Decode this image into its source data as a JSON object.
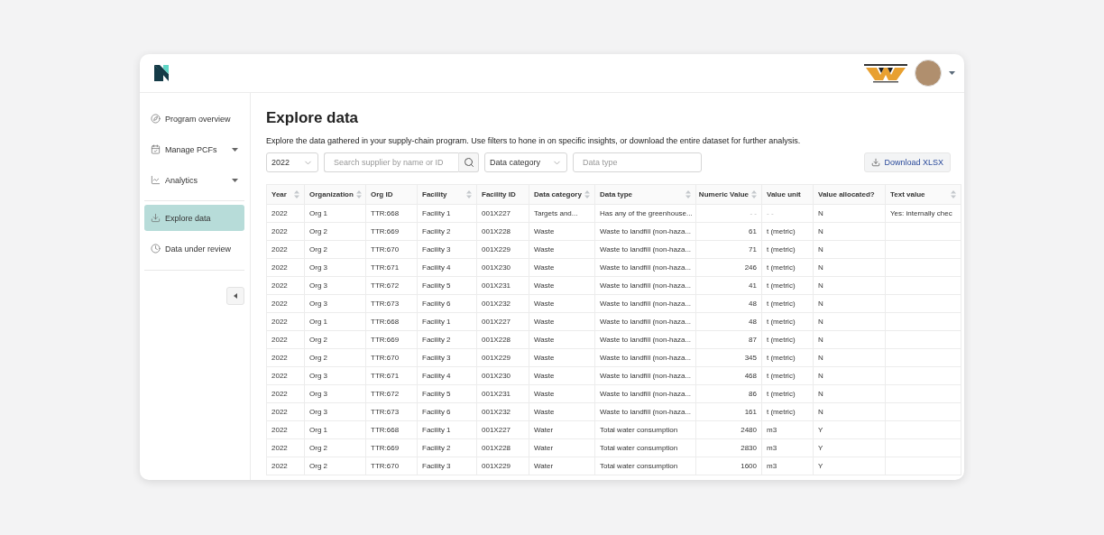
{
  "sidebar": {
    "items": [
      {
        "label": "Program overview",
        "selected": false,
        "expandable": false
      },
      {
        "label": "Manage PCFs",
        "selected": false,
        "expandable": true
      },
      {
        "label": "Analytics",
        "selected": false,
        "expandable": true
      },
      {
        "label": "Explore data",
        "selected": true,
        "expandable": false
      },
      {
        "label": "Data under review",
        "selected": false,
        "expandable": false
      }
    ]
  },
  "page": {
    "title": "Explore data",
    "description": "Explore the data gathered in your supply-chain program. Use filters to hone in on specific insights, or download the entire dataset for further analysis."
  },
  "filters": {
    "year": "2022",
    "search_placeholder": "Search supplier by name or ID",
    "category": "Data category",
    "type_placeholder": "Data type",
    "download": "Download XLSX"
  },
  "table": {
    "columns": [
      {
        "label": "Year",
        "sortable": true,
        "kind": "text"
      },
      {
        "label": "Organization",
        "sortable": true,
        "kind": "text"
      },
      {
        "label": "Org ID",
        "sortable": false,
        "kind": "text"
      },
      {
        "label": "Facility",
        "sortable": true,
        "kind": "text"
      },
      {
        "label": "Facility ID",
        "sortable": false,
        "kind": "text"
      },
      {
        "label": "Data category",
        "sortable": true,
        "kind": "text"
      },
      {
        "label": "Data type",
        "sortable": true,
        "kind": "text"
      },
      {
        "label": "Numeric Value",
        "sortable": true,
        "kind": "number"
      },
      {
        "label": "Value unit",
        "sortable": false,
        "kind": "text"
      },
      {
        "label": "Value allocated?",
        "sortable": false,
        "kind": "text"
      },
      {
        "label": "Text value",
        "sortable": true,
        "kind": "text"
      }
    ],
    "rows": [
      [
        "2022",
        "Org 1",
        "TTR:668",
        "Facility 1",
        "001X227",
        "Targets and...",
        "Has any of the greenhouse...",
        "- -",
        "- -",
        "N",
        "Yes: internally chec"
      ],
      [
        "2022",
        "Org 2",
        "TTR:669",
        "Facility 2",
        "001X228",
        "Waste",
        "Waste to landfill (non-haza...",
        "61",
        "t (metric)",
        "N"
      ],
      [
        "2022",
        "Org 2",
        "TTR:670",
        "Facility 3",
        "001X229",
        "Waste",
        "Waste to landfill (non-haza...",
        "71",
        "t (metric)",
        "N"
      ],
      [
        "2022",
        "Org 3",
        "TTR:671",
        "Facility 4",
        "001X230",
        "Waste",
        "Waste to landfill (non-haza...",
        "246",
        "t (metric)",
        "N"
      ],
      [
        "2022",
        "Org 3",
        "TTR:672",
        "Facility 5",
        "001X231",
        "Waste",
        "Waste to landfill (non-haza...",
        "41",
        "t (metric)",
        "N"
      ],
      [
        "2022",
        "Org 3",
        "TTR:673",
        "Facility 6",
        "001X232",
        "Waste",
        "Waste to landfill (non-haza...",
        "48",
        "t (metric)",
        "N"
      ],
      [
        "2022",
        "Org 1",
        "TTR:668",
        "Facility 1",
        "001X227",
        "Waste",
        "Waste to landfill (non-haza...",
        "48",
        "t (metric)",
        "N"
      ],
      [
        "2022",
        "Org 2",
        "TTR:669",
        "Facility 2",
        "001X228",
        "Waste",
        "Waste to landfill (non-haza...",
        "87",
        "t (metric)",
        "N"
      ],
      [
        "2022",
        "Org 2",
        "TTR:670",
        "Facility 3",
        "001X229",
        "Waste",
        "Waste to landfill (non-haza...",
        "345",
        "t (metric)",
        "N"
      ],
      [
        "2022",
        "Org 3",
        "TTR:671",
        "Facility 4",
        "001X230",
        "Waste",
        "Waste to landfill (non-haza...",
        "468",
        "t (metric)",
        "N"
      ],
      [
        "2022",
        "Org 3",
        "TTR:672",
        "Facility 5",
        "001X231",
        "Waste",
        "Waste to landfill (non-haza...",
        "86",
        "t (metric)",
        "N"
      ],
      [
        "2022",
        "Org 3",
        "TTR:673",
        "Facility 6",
        "001X232",
        "Waste",
        "Waste to landfill (non-haza...",
        "161",
        "t (metric)",
        "N"
      ],
      [
        "2022",
        "Org 1",
        "TTR:668",
        "Facility 1",
        "001X227",
        "Water",
        "Total water consumption",
        "2480",
        "m3",
        "Y"
      ],
      [
        "2022",
        "Org 2",
        "TTR:669",
        "Facility 2",
        "001X228",
        "Water",
        "Total water consumption",
        "2830",
        "m3",
        "Y"
      ],
      [
        "2022",
        "Org 2",
        "TTR:670",
        "Facility 3",
        "001X229",
        "Water",
        "Total water consumption",
        "1600",
        "m3",
        "Y"
      ]
    ]
  }
}
